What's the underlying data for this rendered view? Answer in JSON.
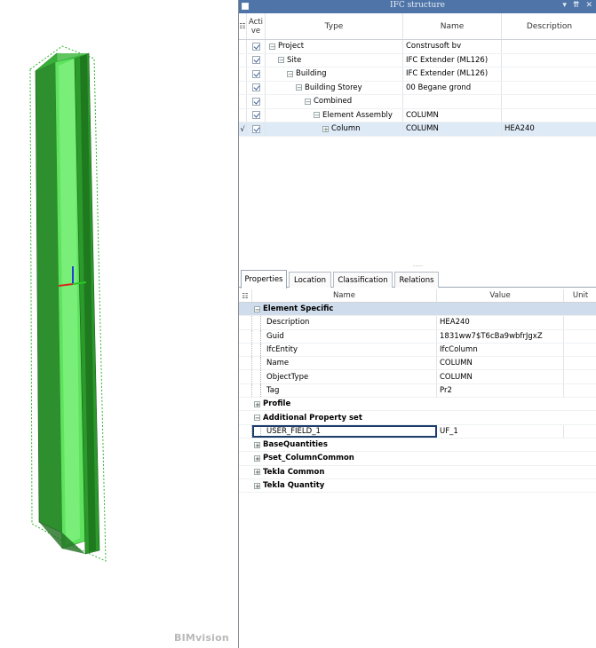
{
  "viewer": {
    "brand": "BIMvision"
  },
  "panel": {
    "title": "IFC structure",
    "controls": [
      "▾",
      "⇈",
      "✕"
    ]
  },
  "tree": {
    "columns": {
      "active": "Acti ve",
      "type": "Type",
      "name": "Name",
      "description": "Description"
    },
    "rows": [
      {
        "marker": "",
        "type": "Project",
        "name": "Construsoft bv",
        "description": ""
      },
      {
        "marker": "",
        "type": "Site",
        "name": "IFC Extender (ML126)",
        "description": ""
      },
      {
        "marker": "",
        "type": "Building",
        "name": "IFC Extender (ML126)",
        "description": ""
      },
      {
        "marker": "",
        "type": "Building Storey",
        "name": "00 Begane grond",
        "description": ""
      },
      {
        "marker": "",
        "type": "Combined",
        "name": "",
        "description": ""
      },
      {
        "marker": "",
        "type": "Element Assembly",
        "name": "COLUMN",
        "description": ""
      },
      {
        "marker": "√",
        "type": "Column",
        "name": "COLUMN",
        "description": "HEA240"
      }
    ]
  },
  "tabs": [
    "Properties",
    "Location",
    "Classification",
    "Relations"
  ],
  "props": {
    "columns": {
      "name": "Name",
      "value": "Value",
      "unit": "Unit"
    },
    "groups": {
      "element_specific": "Element Specific",
      "profile": "Profile",
      "additional": "Additional Property set",
      "base": "BaseQuantities",
      "pset": "Pset_ColumnCommon",
      "tekla_common": "Tekla Common",
      "tekla_quantity": "Tekla Quantity"
    },
    "element_specific": [
      {
        "name": "Description",
        "value": "HEA240"
      },
      {
        "name": "Guid",
        "value": "1831ww7$T6cBa9wbfrJgxZ"
      },
      {
        "name": "IfcEntity",
        "value": "IfcColumn"
      },
      {
        "name": "Name",
        "value": "COLUMN"
      },
      {
        "name": "ObjectType",
        "value": "COLUMN"
      },
      {
        "name": "Tag",
        "value": "Pr2"
      }
    ],
    "additional": [
      {
        "name": "USER_FIELD_1",
        "value": "UF_1"
      }
    ]
  },
  "colors": {
    "titlebar": "#4f74a8",
    "beam": "#3ccf3c",
    "selection": "#dfeaf7",
    "focus_border": "#1a3d6b"
  }
}
